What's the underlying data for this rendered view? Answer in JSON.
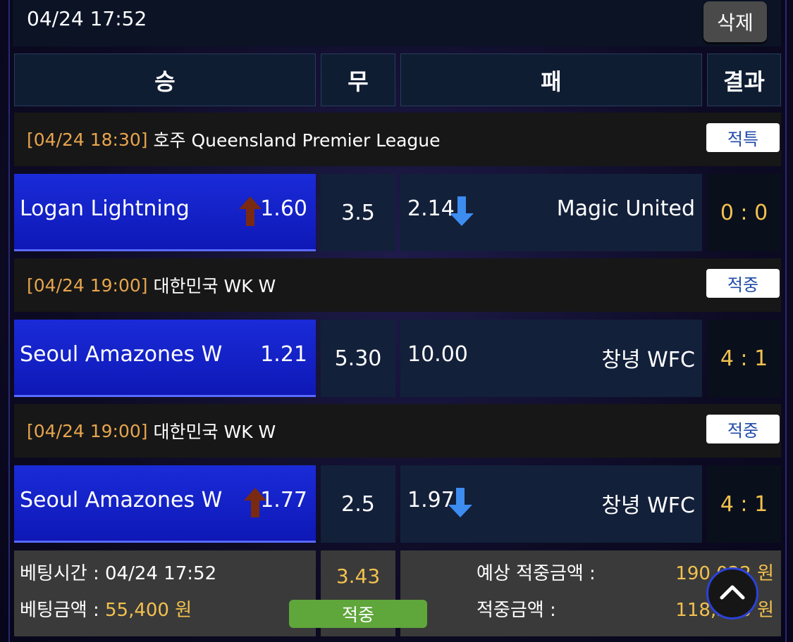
{
  "slip": {
    "datetime": "04/24 17:52",
    "delete_label": "삭제"
  },
  "header": {
    "win": "승",
    "draw": "무",
    "loss": "패",
    "result": "결과"
  },
  "matches": [
    {
      "league_datetime": "[04/24 18:30]",
      "league_name": "호주 Queensland Premier League",
      "tag": "적특",
      "home": "Logan Lightning",
      "home_odd": "1.60",
      "draw_odd": "3.5",
      "away_odd": "2.14",
      "away": "Magic United",
      "score": "0 : 0"
    },
    {
      "league_datetime": "[04/24 19:00]",
      "league_name": "대한민국 WK W",
      "tag": "적중",
      "home": "Seoul Amazones W",
      "home_odd": "1.21",
      "draw_odd": "5.30",
      "away_odd": "10.00",
      "away": "창녕 WFC",
      "score": "4 : 1"
    },
    {
      "league_datetime": "[04/24 19:00]",
      "league_name": "대한민국 WK W",
      "tag": "적중",
      "home": "Seoul Amazones W",
      "home_odd": "1.77",
      "draw_odd": "2.5",
      "away_odd": "1.97",
      "away": "창녕 WFC",
      "score": "4 : 1"
    }
  ],
  "footer": {
    "bet_time_label": "베팅시간 :",
    "bet_time": "04/24 17:52",
    "bet_amount_label": "베팅금액 :",
    "bet_amount": "55,400 원",
    "total_odds": "3.43",
    "status": "적중",
    "expected_label": "예상 적중금액 :",
    "expected_amount": "190,022 원",
    "won_label": "적중금액 :",
    "won_amount": "118,556 원"
  },
  "colors": {
    "selected": "#1a2bd8",
    "accent_orange": "#e7a54d",
    "score_yellow": "#f2c14e",
    "odds_up": "#7a2a10",
    "odds_down": "#3d8cf0",
    "hit_green": "#5fa63b"
  }
}
